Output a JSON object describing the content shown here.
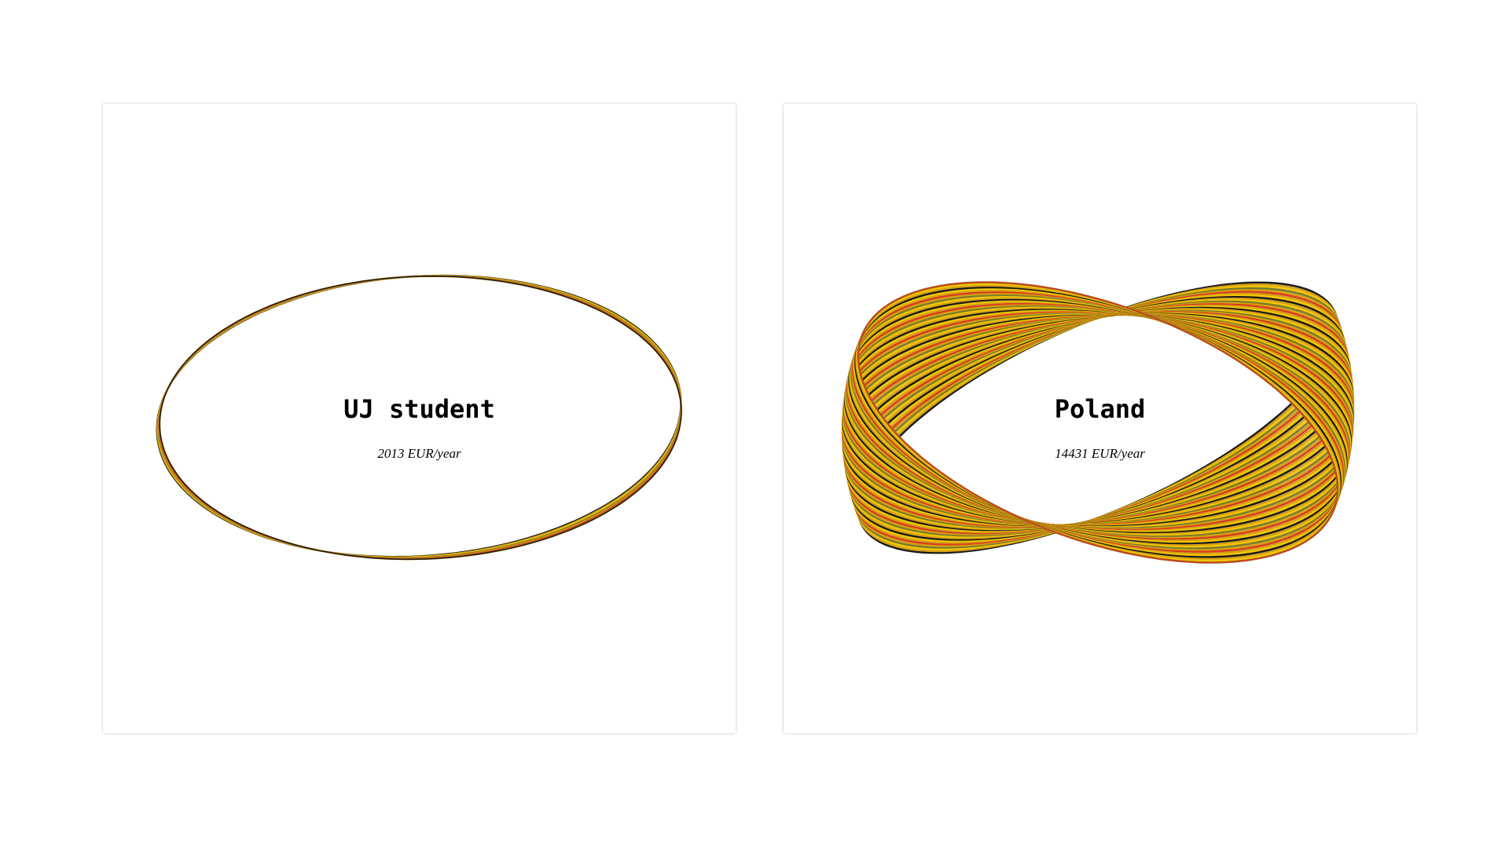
{
  "cards": [
    {
      "title": "UJ student",
      "subtitle": "2013 EUR/year",
      "value_eur_per_year": 2013
    },
    {
      "title": "Poland",
      "subtitle": "14431 EUR/year",
      "value_eur_per_year": 14431
    }
  ],
  "colors": {
    "background": "#ffffff",
    "band_gold": "#d4a017",
    "band_yellow": "#f2c500",
    "band_dark": "#1a1a1a",
    "band_red": "#d93a1c",
    "band_olive": "#7a7a2a"
  }
}
